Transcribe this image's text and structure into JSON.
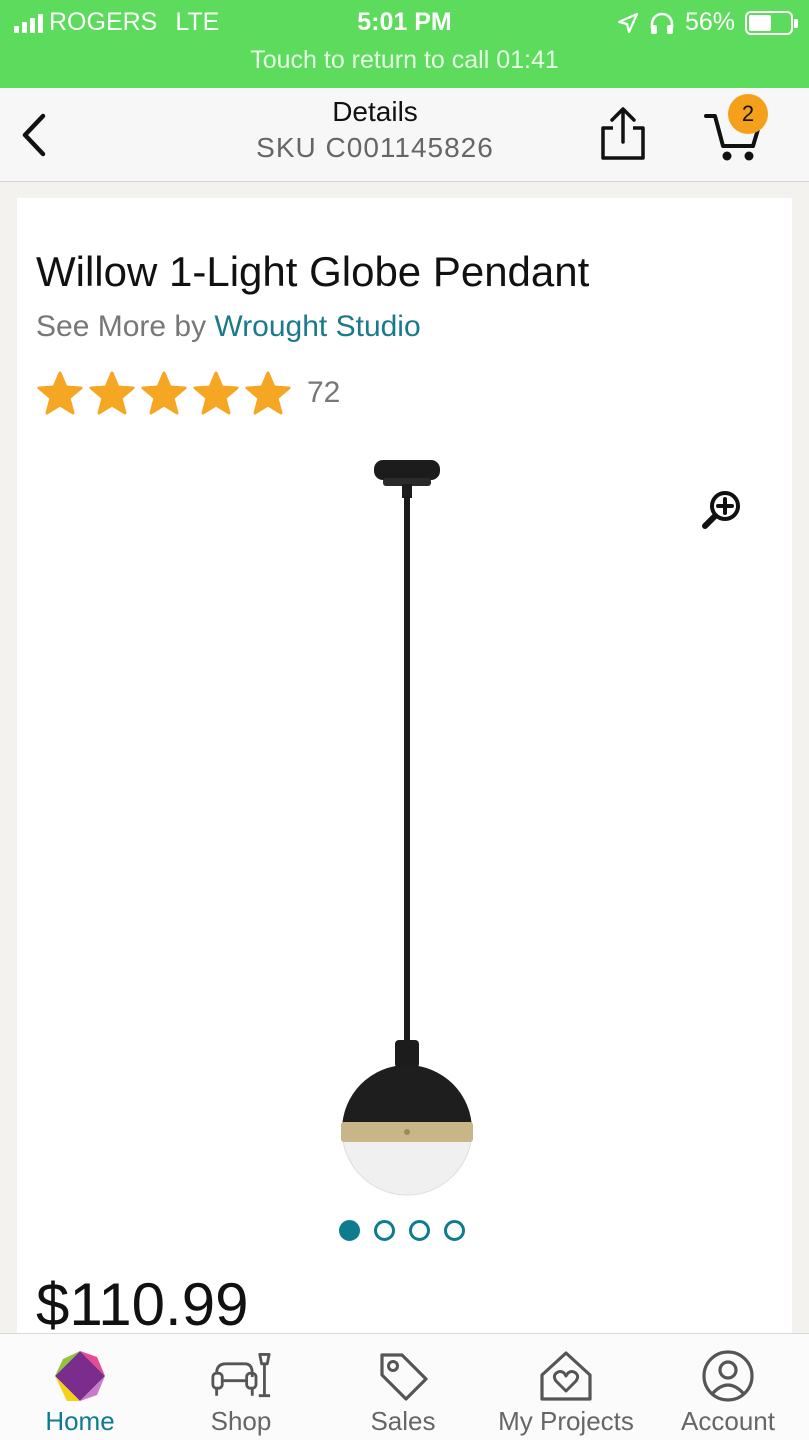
{
  "status_bar": {
    "carrier": "ROGERS",
    "network": "LTE",
    "time": "5:01 PM",
    "battery": "56%",
    "battery_level": 0.56,
    "call_banner": "Touch to return to call 01:41"
  },
  "header": {
    "title": "Details",
    "sku": "SKU C001145826",
    "cart_count": "2"
  },
  "product": {
    "title": "Willow 1-Light Globe Pendant",
    "see_more_prefix": "See More by ",
    "brand": "Wrought Studio",
    "rating_stars": 5,
    "rating_count": "72",
    "image_count": 4,
    "active_image": 1,
    "price": "$110.99"
  },
  "tab_bar": {
    "items": [
      {
        "label": "Home",
        "icon": "home-logo-icon",
        "active": true
      },
      {
        "label": "Shop",
        "icon": "sofa-lamp-icon",
        "active": false
      },
      {
        "label": "Sales",
        "icon": "tag-icon",
        "active": false
      },
      {
        "label": "My Projects",
        "icon": "house-heart-icon",
        "active": false
      },
      {
        "label": "Account",
        "icon": "user-circle-icon",
        "active": false
      }
    ]
  },
  "colors": {
    "status_bar": "#5cdb5c",
    "accent": "#0e7c8e",
    "star": "#f5a623",
    "badge": "#f5a01a"
  }
}
